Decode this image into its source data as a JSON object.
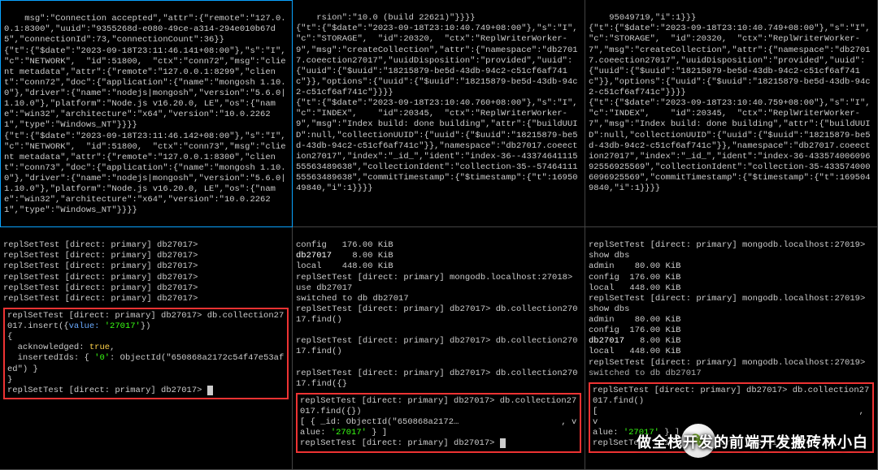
{
  "panes": {
    "top_left": "msg\":\"Connection accepted\",\"attr\":{\"remote\":\"127.0.0.1:8300\",\"uuid\":\"9355268d-e080-49ce-a314-294e010b67d5\",\"connectionId\":73,\"connectionCount\":36}}\n{\"t\":{\"$date\":\"2023-09-18T23:11:46.141+08:00\"},\"s\":\"I\", \"c\":\"NETWORK\",  \"id\":51800,  \"ctx\":\"conn72\",\"msg\":\"client metadata\",\"attr\":{\"remote\":\"127.0.0.1:8299\",\"client\":\"conn72\",\"doc\":{\"application\":{\"name\":\"mongosh 1.10.0\"},\"driver\":{\"name\":\"nodejs|mongosh\",\"version\":\"5.6.0|1.10.0\"},\"platform\":\"Node.js v16.20.0, LE\",\"os\":{\"name\":\"win32\",\"architecture\":\"x64\",\"version\":\"10.0.22621\",\"type\":\"Windows_NT\"}}}}\n{\"t\":{\"$date\":\"2023-09-18T23:11:46.142+08:00\"},\"s\":\"I\", \"c\":\"NETWORK\",  \"id\":51800,  \"ctx\":\"conn73\",\"msg\":\"client metadata\",\"attr\":{\"remote\":\"127.0.0.1:8300\",\"client\":\"conn73\",\"doc\":{\"application\":{\"name\":\"mongosh 1.10.0\"},\"driver\":{\"name\":\"nodejs|mongosh\",\"version\":\"5.6.0|1.10.0\"},\"platform\":\"Node.js v16.20.0, LE\",\"os\":{\"name\":\"win32\",\"architecture\":\"x64\",\"version\":\"10.0.22621\",\"type\":\"Windows_NT\"}}}}",
    "top_mid": "rsion\":\"10.0 (build 22621)\"}}}}\n{\"t\":{\"$date\":\"2023-09-18T23:10:40.749+08:00\"},\"s\":\"I\",  \"c\":\"STORAGE\",  \"id\":20320,  \"ctx\":\"ReplWriterWorker-9\",\"msg\":\"createCollection\",\"attr\":{\"namespace\":\"db27017.coeection27017\",\"uuidDisposition\":\"provided\",\"uuid\":{\"uuid\":{\"$uuid\":\"18215879-be5d-43db-94c2-c51cf6af741c\"}},\"options\":{\"uuid\":{\"$uuid\":\"18215879-be5d-43db-94c2-c51cf6af741c\"}}}}\n{\"t\":{\"$date\":\"2023-09-18T23:10:40.760+08:00\"},\"s\":\"I\",  \"c\":\"INDEX\",    \"id\":20345,  \"ctx\":\"ReplWriterWorker-9\",\"msg\":\"Index build: done building\",\"attr\":{\"buildUUID\":null,\"collectionUUID\":{\"uuid\":{\"$uuid\":\"18215879-be5d-43db-94c2-c51cf6af741c\"}},\"namespace\":\"db27017.coeection27017\",\"index\":\"_id_\",\"ident\":\"index-36--4337464111555563489638\",\"collectionIdent\":\"collection-35--5746411155563489638\",\"commitTimestamp\":{\"$timestamp\":{\"t\":1695049840,\"i\":1}}}}",
    "top_right": "95049719,\"i\":1}}}\n{\"t\":{\"$date\":\"2023-09-18T23:10:40.749+08:00\"},\"s\":\"I\",  \"c\":\"STORAGE\",  \"id\":20320,  \"ctx\":\"ReplWriterWorker-7\",\"msg\":\"createCollection\",\"attr\":{\"namespace\":\"db27017.coeection27017\",\"uuidDisposition\":\"provided\",\"uuid\":{\"uuid\":{\"$uuid\":\"18215879-be5d-43db-94c2-c51cf6af741c\"}},\"options\":{\"uuid\":{\"$uuid\":\"18215879-be5d-43db-94c2-c51cf6af741c\"}}}}\n{\"t\":{\"$date\":\"2023-09-18T23:10:40.759+08:00\"},\"s\":\"I\",  \"c\":\"INDEX\",    \"id\":20345,  \"ctx\":\"ReplWriterWorker-7\",\"msg\":\"Index build: done building\",\"attr\":{\"buildUUID\":null,\"collectionUUID\":{\"uuid\":{\"$uuid\":\"18215879-be5d-43db-94c2-c51cf6af741c\"}},\"namespace\":\"db27017.coeection27017\",\"index\":\"_id_\",\"ident\":\"index-36-43357400609692556925569\",\"collectionIdent\":\"collection-35-4335740006096925569\",\"commitTimestamp\":{\"$timestamp\":{\"t\":1695049840,\"i\":1}}}}"
  },
  "shell": {
    "left": {
      "prompts": [
        "replSetTest [direct: primary] db27017>",
        "replSetTest [direct: primary] db27017>",
        "replSetTest [direct: primary] db27017>",
        "replSetTest [direct: primary] db27017>",
        "replSetTest [direct: primary] db27017>",
        "replSetTest [direct: primary] db27017>"
      ],
      "box": {
        "line1a": "replSetTest [direct: primary] db27017> db.collection27017.insert({",
        "line1b": "value:",
        "line1c": "'27017'",
        "line1d": "})",
        "line2": "{",
        "line3a": "  acknowledged:",
        "line3b": "true",
        "line3c": ",",
        "line4a": "  insertedIds: {",
        "line4b": "'0'",
        "line4c": ": ObjectId(\"650868a2172c54f47e53afed\") }",
        "line5": "}",
        "line6": "replSetTest [direct: primary] db27017> "
      }
    },
    "mid": {
      "lines_pre": [
        "config   176.00 KiB",
        "",
        "local    448.00 KiB",
        "replSetTest [direct: primary] mongodb.localhost:27018> use db27017",
        "switched to db db27017",
        "replSetTest [direct: primary] db27017> db.collection27017.find()",
        "",
        "replSetTest [direct: primary] db27017> db.collection27017.find()",
        "",
        "replSetTest [direct: primary] db27017> db.collection27017.find({}"
      ],
      "db_line_a": "db27017",
      "db_line_b": "    8.00 KiB",
      "box": {
        "l1": "replSetTest [direct: primary] db27017> db.collection27017.find({})",
        "l2a": "[ { _id: ObjectId(\"650868a2172…",
        "l2b": "                    , v",
        "l3a": "alue:",
        "l3b": "'27017'",
        "l3c": " } ]",
        "l4": "replSetTest [direct: primary] db27017> "
      }
    },
    "right": {
      "lines": [
        "replSetTest [direct: primary] mongodb.localhost:27019> show dbs",
        "admin    80.00 KiB",
        "config  176.00 KiB",
        "local   448.00 KiB",
        "replSetTest [direct: primary] mongodb.localhost:27019> show dbs",
        "admin    80.00 KiB",
        "config  176.00 KiB",
        "",
        "local   448.00 KiB",
        "replSetTest [direct: primary] mongodb.localhost:27019>"
      ],
      "db_line_a": "db27017",
      "db_line_b": "   8.00 KiB",
      "switched": "switched to db db27017",
      "box": {
        "l1": "replSetTest [direct: primary] db27017> db.collection27017.find()",
        "l2": "[                                                   , v",
        "l3b": "'27017'",
        "l4": "replSetTest [direct: primary] db27017> "
      }
    }
  },
  "overlay": "做全栈开发的前端开发搬砖林小白",
  "colors": {
    "active_border": "#0aa3ff",
    "highlight_box": "#e33",
    "green": "#39ff14",
    "yellow": "#ffd24a"
  }
}
